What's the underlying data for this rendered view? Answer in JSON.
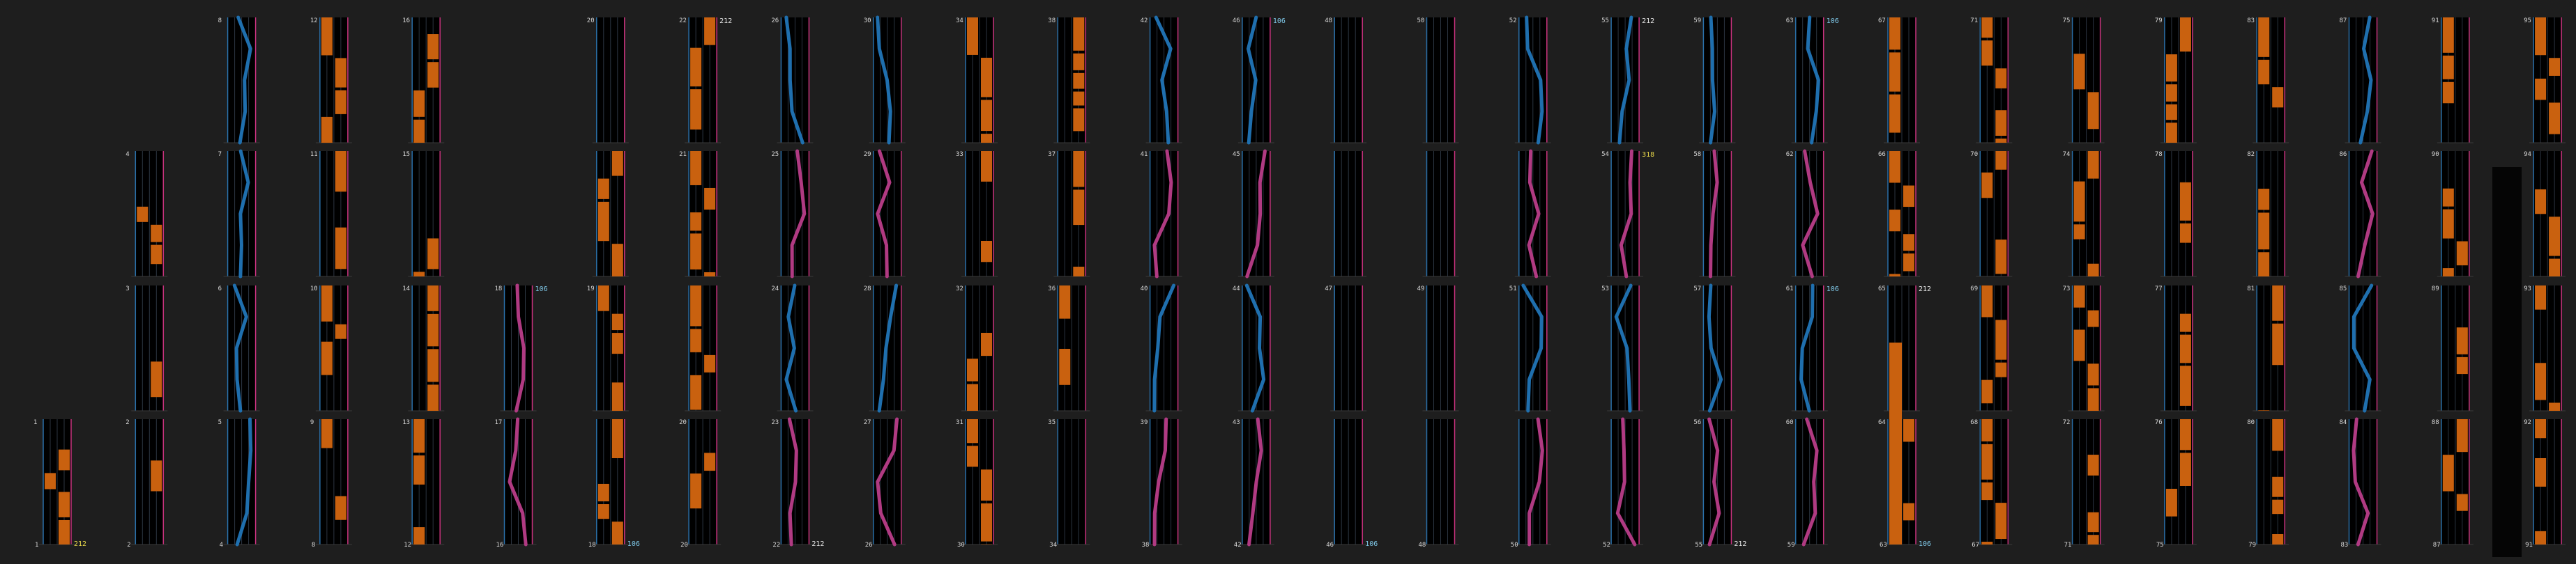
{
  "theme": {
    "background": "#1e1e1e",
    "panel_bg": "#000000",
    "grid": "#2b3440",
    "border_left": "#2a6fa8",
    "border_right": "#c8327d",
    "orange": "#c9610f",
    "orange_light": "#e8892a",
    "blue": "#1f6fae",
    "magenta": "#b03a82",
    "label": "#d8d8d8",
    "value_yellow": "#e8d84a",
    "value_cyan": "#7fc8e8"
  },
  "view": {
    "columns": 28,
    "rows": 4
  },
  "indices": {
    "c0": [
      "",
      "",
      "",
      "1"
    ],
    "c1": [
      "",
      "4",
      "3",
      "2"
    ],
    "c2": [
      "8",
      "7",
      "6",
      "5"
    ],
    "c3": [
      "12",
      "11",
      "10",
      "9"
    ],
    "c4": [
      "16",
      "15",
      "14",
      "13"
    ],
    "c5": [
      "",
      "",
      "18",
      "17"
    ],
    "c6": [
      "20",
      "",
      "19",
      ""
    ],
    "c7": [
      "22",
      "21",
      "",
      "20"
    ],
    "c8": [
      "26",
      "25",
      "24",
      "23"
    ],
    "c9": [
      "30",
      "29",
      "28",
      "27"
    ],
    "c10": [
      "34",
      "33",
      "32",
      "31"
    ],
    "c11": [
      "38",
      "37",
      "36",
      "35"
    ],
    "c12": [
      "42",
      "41",
      "40",
      "39"
    ],
    "c13": [
      "46",
      "45",
      "44",
      "43"
    ],
    "c14": [
      "48",
      "",
      "47",
      ""
    ],
    "c15": [
      "50",
      "",
      "49",
      ""
    ],
    "c16": [
      "52",
      "",
      "51",
      ""
    ],
    "c17": [
      "55",
      "54",
      "53",
      ""
    ],
    "c18": [
      "59",
      "58",
      "57",
      "56"
    ],
    "c19": [
      "63",
      "62",
      "61",
      "60"
    ],
    "c20": [
      "67",
      "66",
      "65",
      "64"
    ],
    "c21": [
      "71",
      "70",
      "69",
      "68"
    ],
    "c22": [
      "75",
      "74",
      "73",
      "72"
    ],
    "c23": [
      "79",
      "78",
      "77",
      "76"
    ],
    "c24": [
      "83",
      "82",
      "81",
      "80"
    ],
    "c25": [
      "87",
      "86",
      "85",
      "84"
    ],
    "c26": [
      "91",
      "90",
      "89",
      "88"
    ],
    "c27": [
      "95",
      "94",
      "93",
      "92"
    ]
  },
  "bottom_indices": [
    "1",
    "2",
    "4",
    "8",
    "12",
    "16",
    "18",
    "20",
    "22",
    "26",
    "30",
    "34",
    "38",
    "42",
    "46",
    "48",
    "50",
    "52",
    "55",
    "59",
    "63",
    "67",
    "71",
    "75",
    "79",
    "83",
    "87",
    "91"
  ],
  "value_tags": [
    {
      "col": 0,
      "row": 3,
      "text": "212",
      "color": "yellow",
      "pos": "bottom"
    },
    {
      "col": 5,
      "row": 2,
      "text": "106",
      "color": "cyan",
      "pos": "top"
    },
    {
      "col": 6,
      "row": 3,
      "text": "106",
      "color": "cyan",
      "pos": "bottom"
    },
    {
      "col": 7,
      "row": 0,
      "text": "212",
      "color": "white",
      "pos": "top"
    },
    {
      "col": 8,
      "row": 3,
      "text": "212",
      "color": "white",
      "pos": "bottom"
    },
    {
      "col": 13,
      "row": 0,
      "text": "106",
      "color": "cyan",
      "pos": "top"
    },
    {
      "col": 14,
      "row": 3,
      "text": "106",
      "color": "cyan",
      "pos": "bottom"
    },
    {
      "col": 17,
      "row": 0,
      "text": "212",
      "color": "white",
      "pos": "top"
    },
    {
      "col": 17,
      "row": 1,
      "text": "318",
      "color": "yellow",
      "pos": "top"
    },
    {
      "col": 18,
      "row": 3,
      "text": "212",
      "color": "white",
      "pos": "bottom"
    },
    {
      "col": 19,
      "row": 0,
      "text": "106",
      "color": "cyan",
      "pos": "top"
    },
    {
      "col": 19,
      "row": 2,
      "text": "106",
      "color": "cyan",
      "pos": "top"
    },
    {
      "col": 20,
      "row": 2,
      "text": "212",
      "color": "white",
      "pos": "top"
    },
    {
      "col": 20,
      "row": 3,
      "text": "106",
      "color": "cyan",
      "pos": "bottom"
    }
  ]
}
